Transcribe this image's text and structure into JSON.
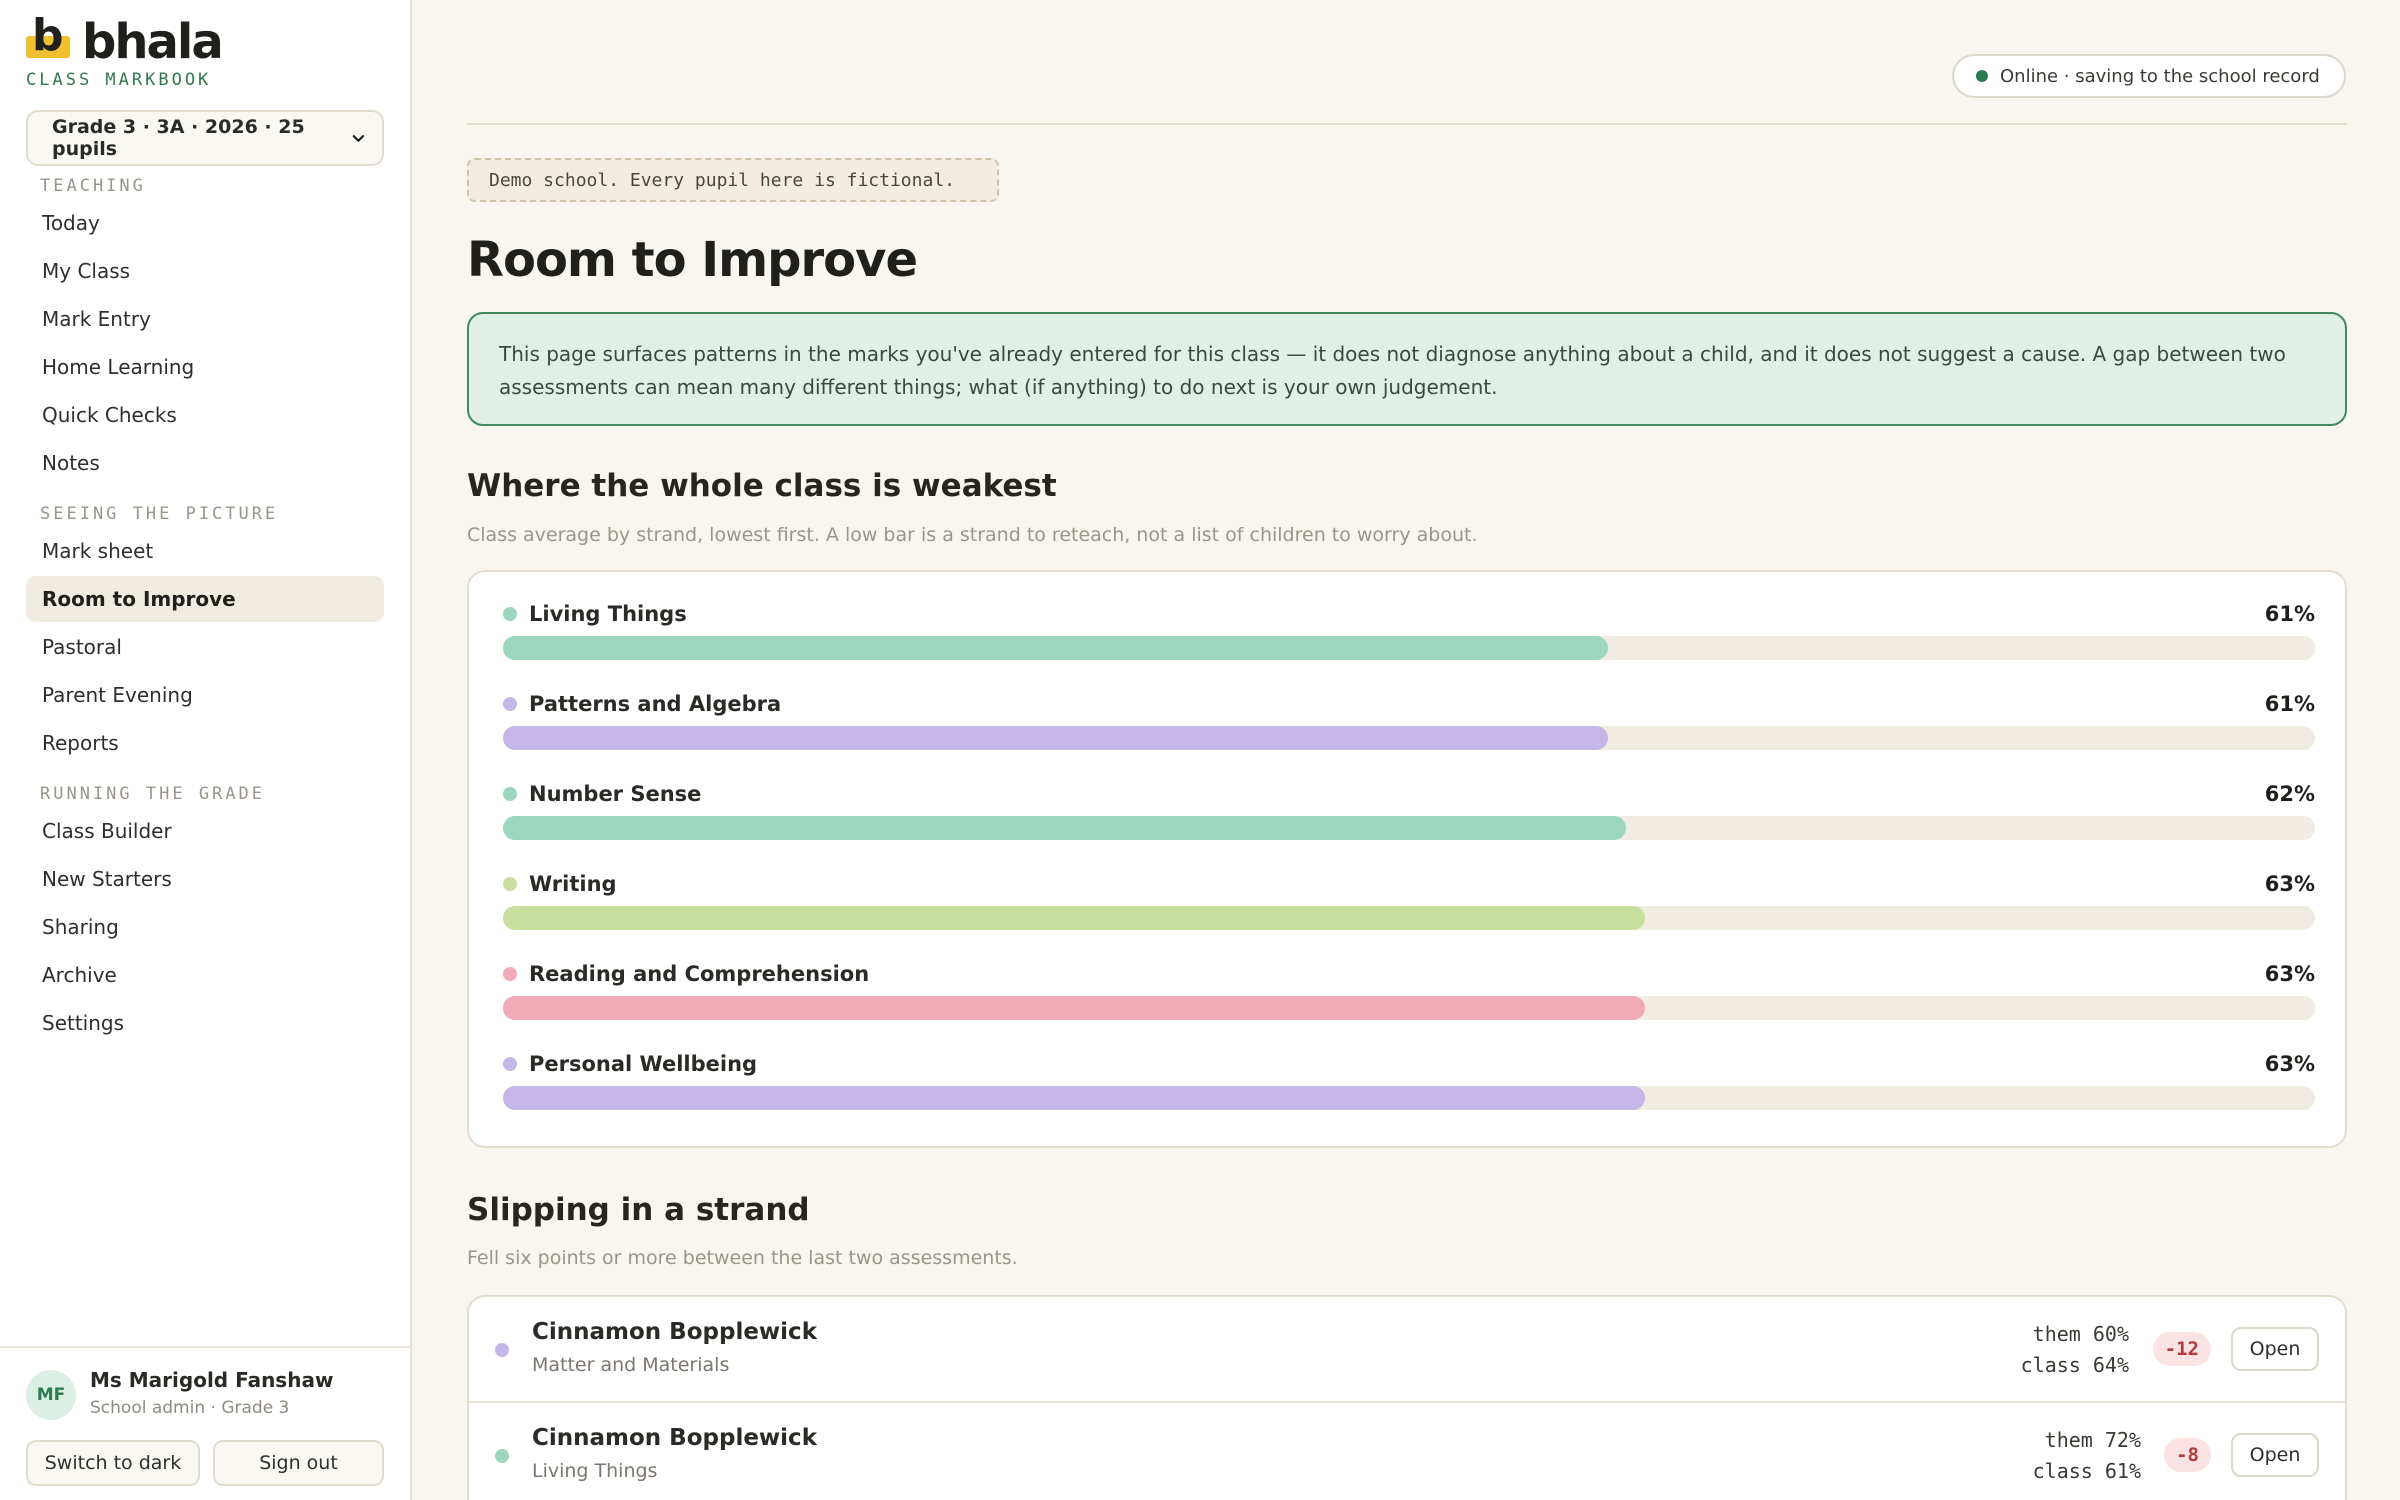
{
  "brand": {
    "name": "bhala",
    "subtitle": "CLASS MARKBOOK",
    "accent": "#f0c030"
  },
  "class_selector": {
    "value": "Grade 3 · 3A · 2026 · 25 pupils"
  },
  "nav": {
    "groups": [
      {
        "label": "TEACHING",
        "items": [
          "Today",
          "My Class",
          "Mark Entry",
          "Home Learning",
          "Quick Checks",
          "Notes"
        ]
      },
      {
        "label": "SEEING THE PICTURE",
        "items": [
          "Mark sheet",
          "Room to Improve",
          "Pastoral",
          "Parent Evening",
          "Reports"
        ]
      },
      {
        "label": "RUNNING THE GRADE",
        "items": [
          "Class Builder",
          "New Starters",
          "Sharing",
          "Archive",
          "Settings"
        ]
      }
    ],
    "active": "Room to Improve"
  },
  "user": {
    "initials": "MF",
    "name": "Ms Marigold Fanshaw",
    "role": "School admin · Grade 3",
    "dark_button": "Switch to dark",
    "signout_button": "Sign out"
  },
  "status": {
    "text": "Online · saving to the school record",
    "color": "#2f7a4f"
  },
  "demo_notice": "Demo school. Every pupil here is fictional.",
  "page_title": "Room to Improve",
  "info_text": "This page surfaces patterns in the marks you've already entered for this class — it does not diagnose anything about a child, and it does not suggest a cause. A gap between two assessments can mean many different things; what (if anything) to do next is your own judgement.",
  "weakest": {
    "title": "Where the whole class is weakest",
    "subtitle": "Class average by strand, lowest first. A low bar is a strand to reteach, not a list of children to worry about.",
    "strands": [
      {
        "name": "Living Things",
        "pct_label": "61%",
        "value": 61,
        "color": "#9dd6bf"
      },
      {
        "name": "Patterns and Algebra",
        "pct_label": "61%",
        "value": 61,
        "color": "#c4b6e6"
      },
      {
        "name": "Number Sense",
        "pct_label": "62%",
        "value": 62,
        "color": "#9dd6bf"
      },
      {
        "name": "Writing",
        "pct_label": "63%",
        "value": 63,
        "color": "#c9df9e"
      },
      {
        "name": "Reading and Comprehension",
        "pct_label": "63%",
        "value": 63,
        "color": "#f0aab8"
      },
      {
        "name": "Personal Wellbeing",
        "pct_label": "63%",
        "value": 63,
        "color": "#c4b6e6"
      }
    ]
  },
  "slipping": {
    "title": "Slipping in a strand",
    "subtitle": "Fell six points or more between the last two assessments.",
    "rows": [
      {
        "name": "Cinnamon Bopplewick",
        "strand": "Matter and Materials",
        "them": "them 60%",
        "class": "class 64%",
        "delta": "-12",
        "open": "Open",
        "color": "#c4b6e6"
      },
      {
        "name": "Cinnamon Bopplewick",
        "strand": "Living Things",
        "them": "them 72%",
        "class": "class 61%",
        "delta": "-8",
        "open": "Open",
        "color": "#9dd6bf"
      }
    ]
  }
}
